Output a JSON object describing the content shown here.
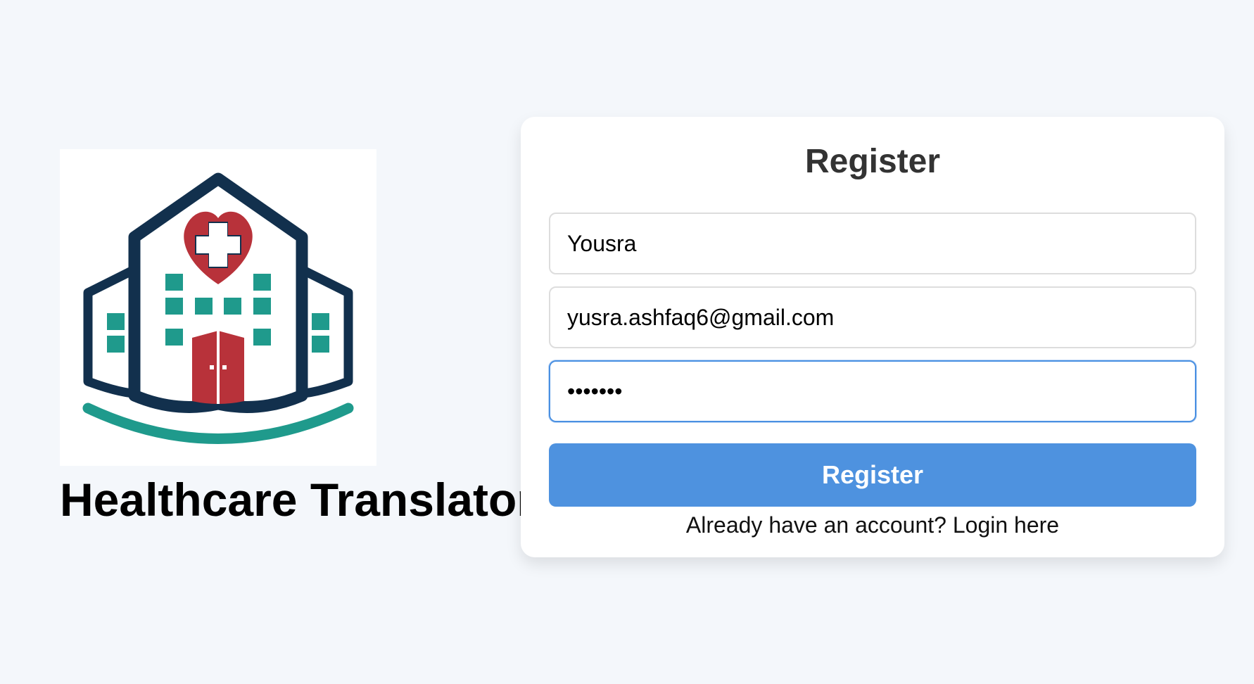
{
  "brand": {
    "title": "Healthcare Translator",
    "logo_icon": "hospital-logo-icon"
  },
  "register_form": {
    "title": "Register",
    "fields": {
      "name": {
        "value": "Yousra"
      },
      "email": {
        "value": "yusra.ashfaq6@gmail.com"
      },
      "password": {
        "value": "•••••••"
      }
    },
    "submit_label": "Register",
    "login_prompt": "Already have an account?",
    "login_link": "Login here"
  },
  "colors": {
    "background": "#f4f7fb",
    "accent": "#4e92df",
    "logo_navy": "#12304d",
    "logo_teal": "#1f9a8c",
    "logo_red": "#b8323a"
  }
}
